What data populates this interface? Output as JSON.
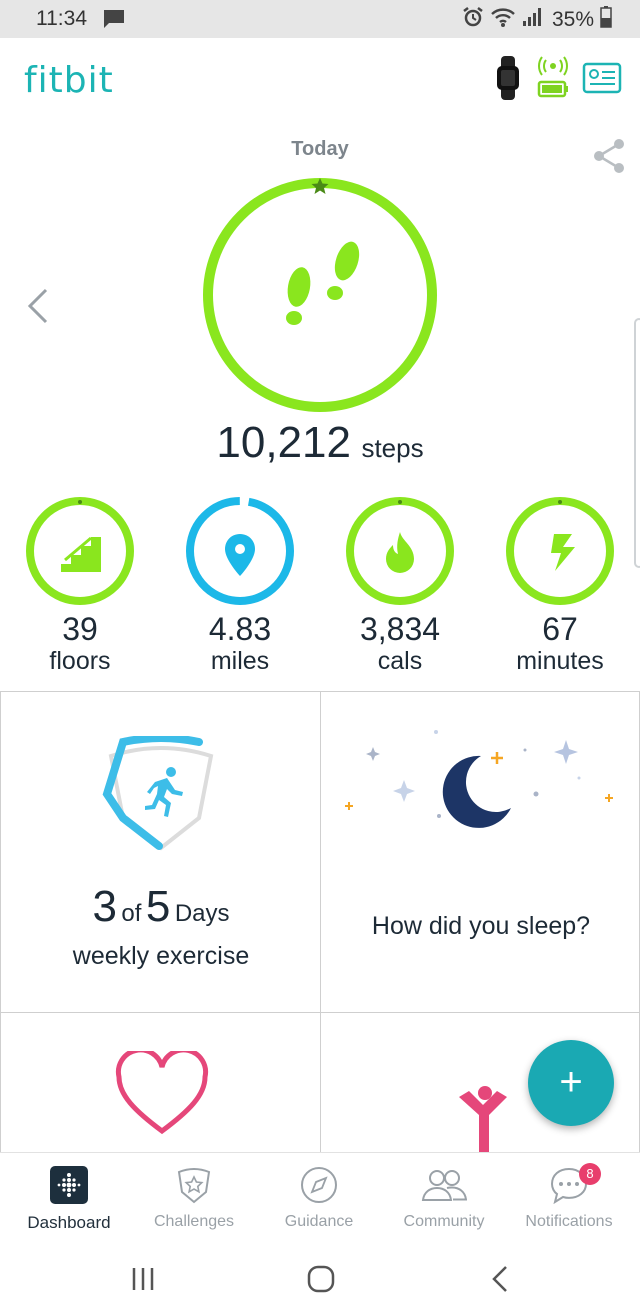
{
  "status_bar": {
    "time": "11:34",
    "battery_percent": "35%"
  },
  "header": {
    "logo": "fitbit"
  },
  "today": {
    "label": "Today",
    "steps_value": "10,212",
    "steps_unit": "steps",
    "steps_goal_progress": 1.0
  },
  "stats": [
    {
      "value": "39",
      "label": "floors",
      "icon": "stairs-icon",
      "color": "#8ae61e",
      "progress": 1.0
    },
    {
      "value": "4.83",
      "label": "miles",
      "icon": "location-pin-icon",
      "color": "#1cb8e8",
      "progress": 0.97
    },
    {
      "value": "3,834",
      "label": "cals",
      "icon": "flame-icon",
      "color": "#8ae61e",
      "progress": 1.0
    },
    {
      "value": "67",
      "label": "minutes",
      "icon": "lightning-icon",
      "color": "#8ae61e",
      "progress": 1.0
    }
  ],
  "exercise": {
    "days_done": "3",
    "of_text": "of",
    "days_goal": "5",
    "days_text": "Days",
    "subtitle": "weekly exercise"
  },
  "sleep": {
    "question": "How did you sleep?"
  },
  "fab": {
    "label": "+"
  },
  "bottom_nav": [
    {
      "label": "Dashboard",
      "icon": "dashboard-icon",
      "active": true
    },
    {
      "label": "Challenges",
      "icon": "challenges-icon"
    },
    {
      "label": "Guidance",
      "icon": "compass-icon"
    },
    {
      "label": "Community",
      "icon": "community-icon"
    },
    {
      "label": "Notifications",
      "icon": "notifications-icon",
      "badge": "8"
    }
  ],
  "colors": {
    "accent": "#1cb4b4",
    "goal_green": "#8ae61e",
    "distance_blue": "#1cb8e8",
    "heart_pink": "#e5477a",
    "moon_navy": "#1d3566"
  }
}
